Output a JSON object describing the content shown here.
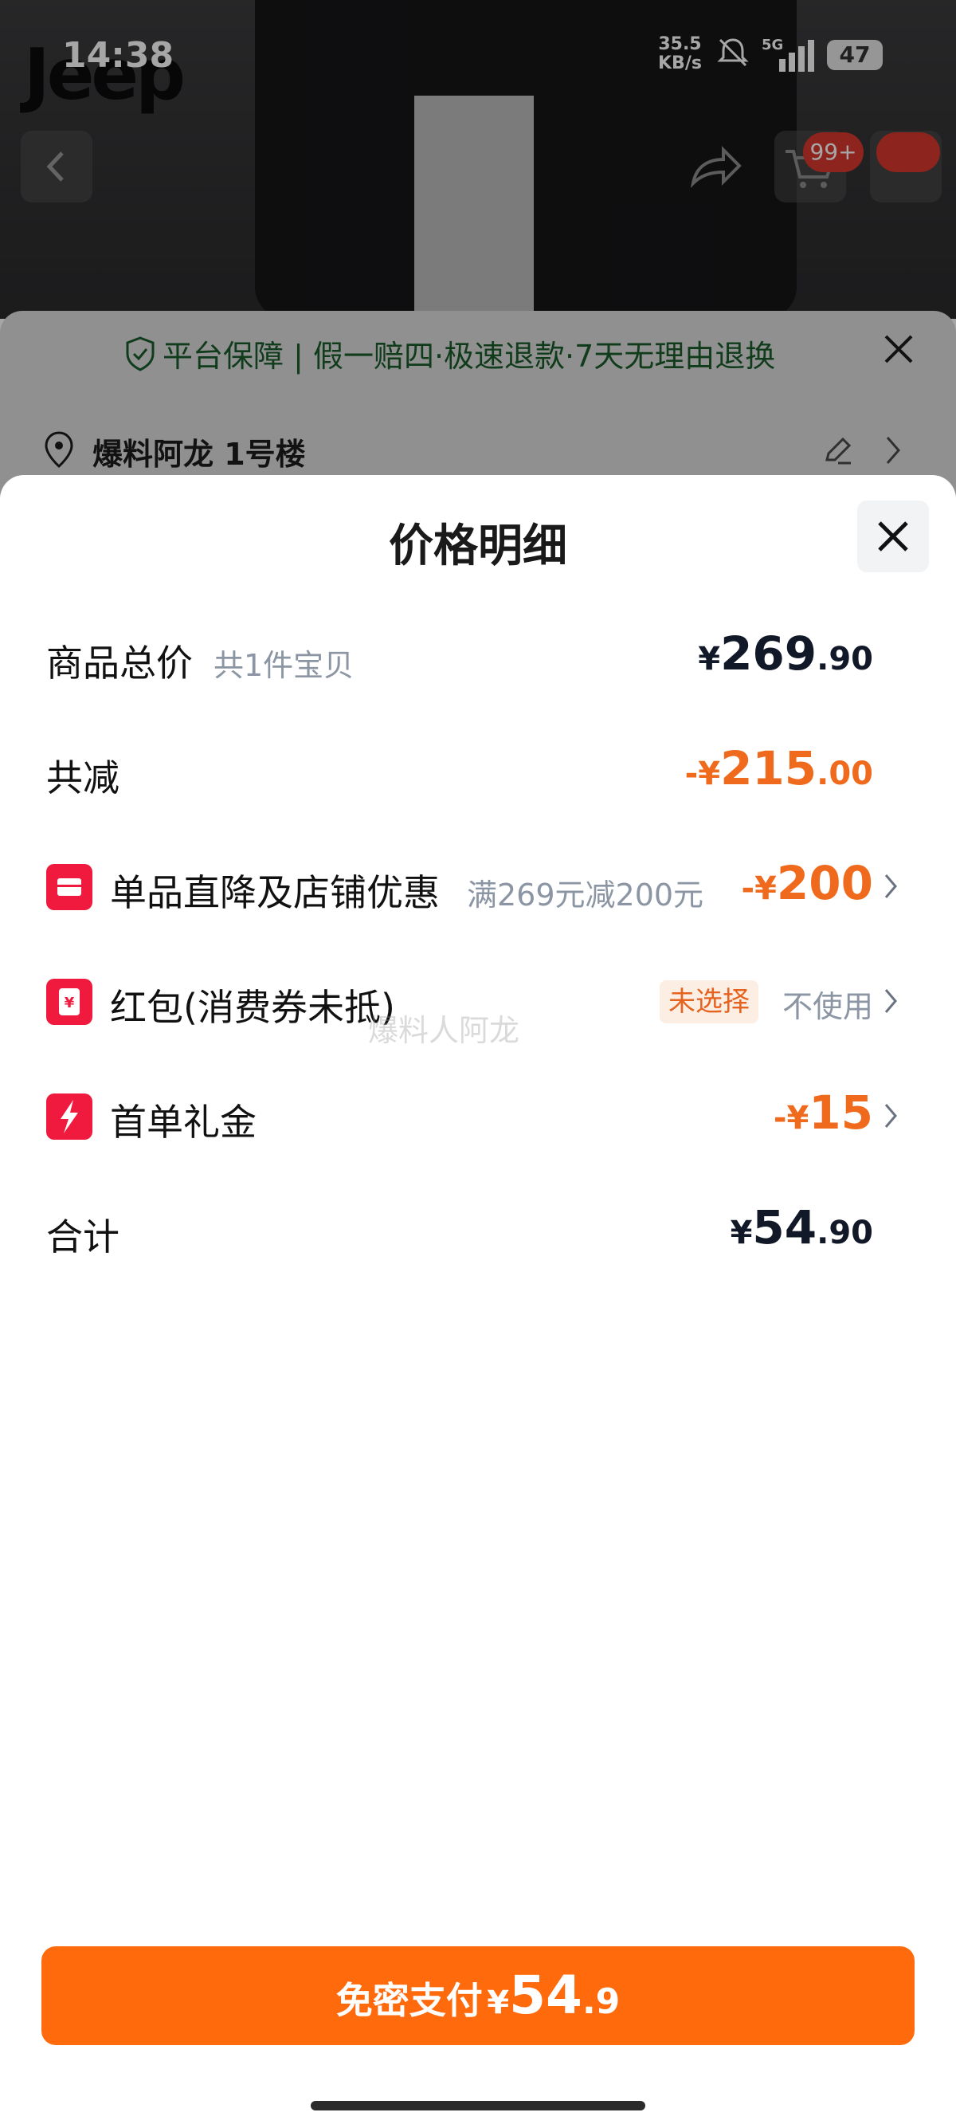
{
  "status_bar": {
    "time": "14:38",
    "net_speed_value": "35.5",
    "net_speed_unit": "KB/s",
    "network": "5G",
    "battery": "47"
  },
  "brand": {
    "logo_text": "Jeep"
  },
  "nav": {
    "cart_badge": "99+"
  },
  "guarantee": {
    "text": "平台保障 | 假一赔四·极速退款·7天无理由退换"
  },
  "address": {
    "text": "爆料阿龙 1号楼"
  },
  "sheet": {
    "title": "价格明细",
    "rows": {
      "total": {
        "label": "商品总价",
        "sub": "共1件宝贝",
        "currency": "¥",
        "int": "269",
        "dec": ".90"
      },
      "discount": {
        "label": "共减",
        "currency": "-¥",
        "int": "215",
        "dec": ".00"
      },
      "store": {
        "label": "单品直降及店铺优惠",
        "sub": "满269元减200元",
        "currency": "-¥",
        "int": "200"
      },
      "redpacket": {
        "label": "红包(消费券未抵)",
        "tag": "未选择",
        "status": "不使用"
      },
      "firstorder": {
        "label": "首单礼金",
        "currency": "-¥",
        "int": "15"
      },
      "sum": {
        "label": "合计",
        "currency": "¥",
        "int": "54",
        "dec": ".90"
      }
    },
    "watermark": "爆料人阿龙"
  },
  "pay": {
    "label": "免密支付",
    "currency": "¥",
    "int": "54",
    "dec": ".9"
  },
  "colors": {
    "accent_orange": "#ff6a0c",
    "discount_orange": "#ef6a1c",
    "icon_red": "#f0193e",
    "guarantee_green": "#1b5c2c"
  }
}
